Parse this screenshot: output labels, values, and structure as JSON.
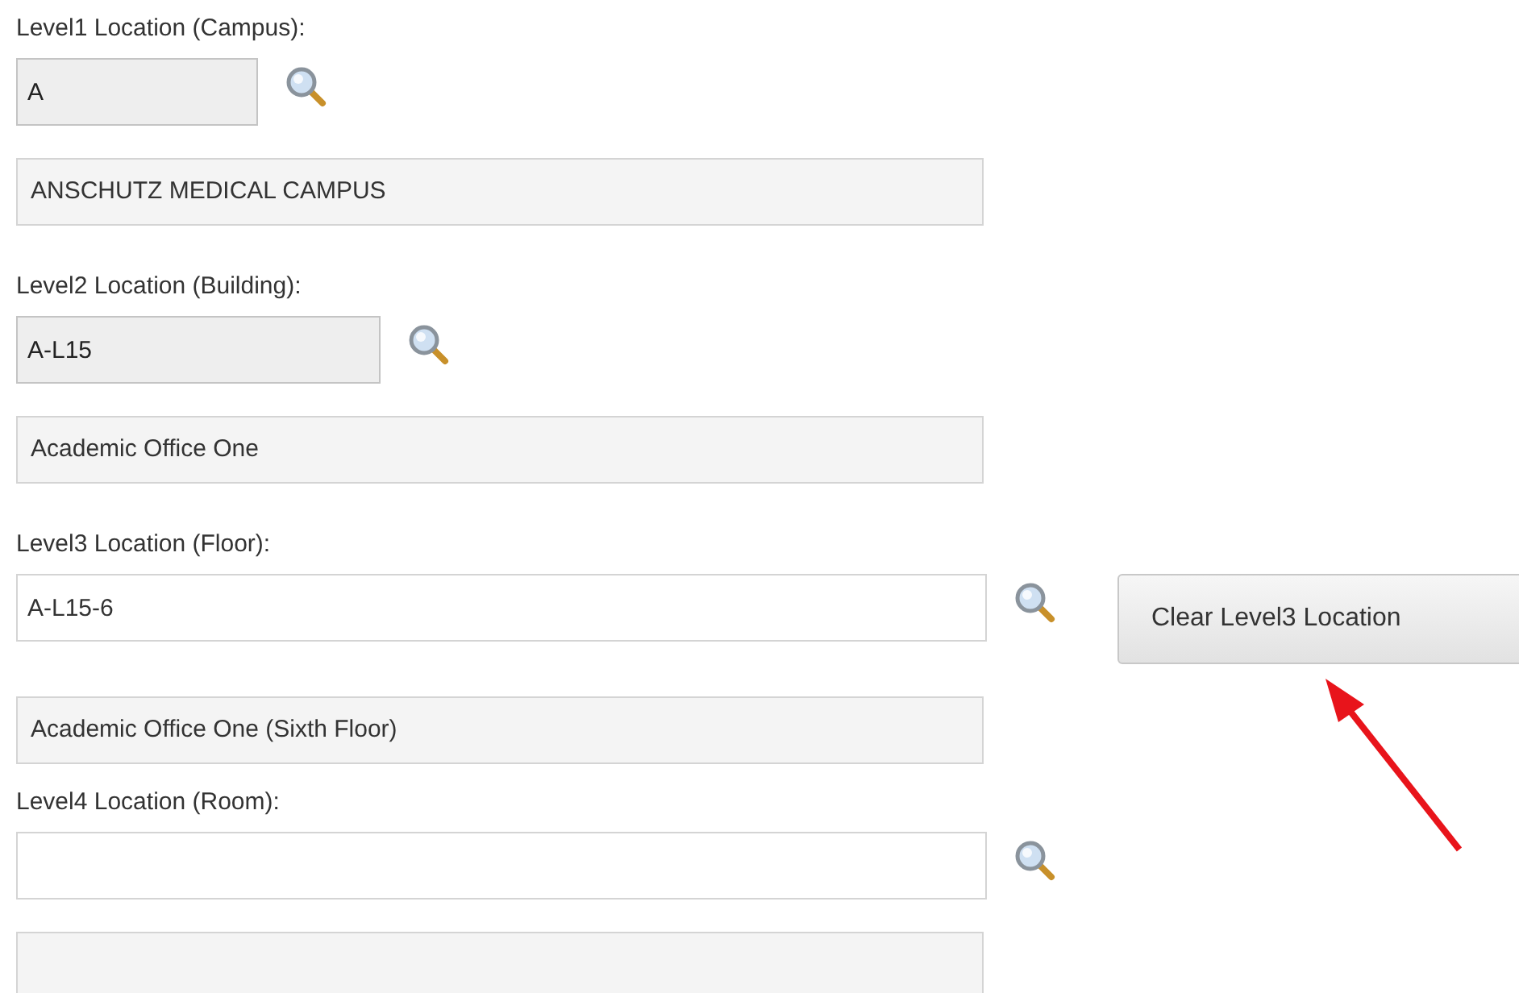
{
  "fields": [
    {
      "label": "Level1 Location (Campus):",
      "value": "A",
      "readonly": true,
      "description": "ANSCHUTZ MEDICAL CAMPUS"
    },
    {
      "label": "Level2 Location (Building):",
      "value": "A-L15",
      "readonly": true,
      "description": "Academic Office One"
    },
    {
      "label": "Level3 Location (Floor):",
      "value": "A-L15-6",
      "readonly": false,
      "description": "Academic Office One (Sixth Floor)",
      "button": {
        "label": "Clear Level3 Location"
      }
    },
    {
      "label": "Level4 Location (Room):",
      "readonly": false
    }
  ]
}
